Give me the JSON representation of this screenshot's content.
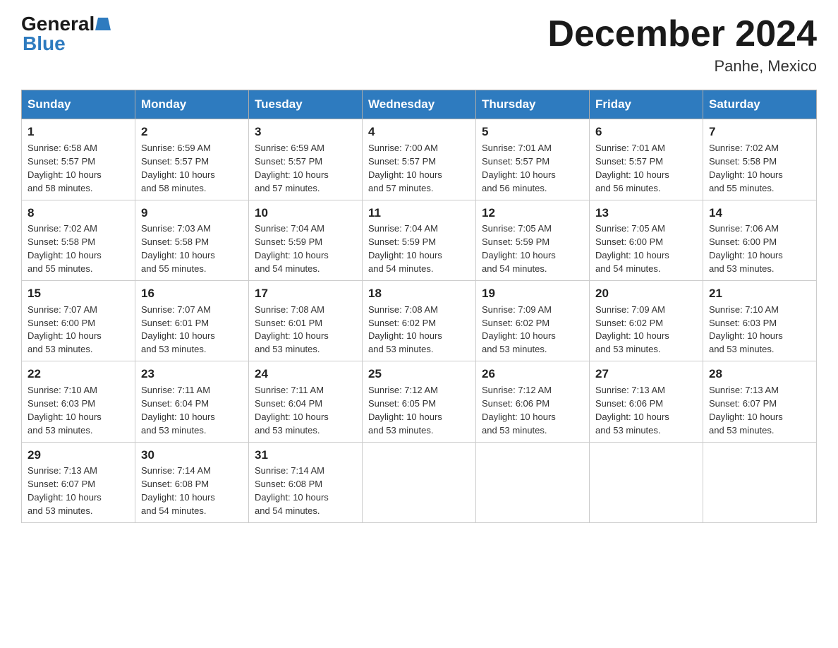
{
  "header": {
    "logo_general": "General",
    "logo_blue": "Blue",
    "month_title": "December 2024",
    "location": "Panhe, Mexico"
  },
  "weekdays": [
    "Sunday",
    "Monday",
    "Tuesday",
    "Wednesday",
    "Thursday",
    "Friday",
    "Saturday"
  ],
  "weeks": [
    [
      {
        "day": "1",
        "info": "Sunrise: 6:58 AM\nSunset: 5:57 PM\nDaylight: 10 hours\nand 58 minutes."
      },
      {
        "day": "2",
        "info": "Sunrise: 6:59 AM\nSunset: 5:57 PM\nDaylight: 10 hours\nand 58 minutes."
      },
      {
        "day": "3",
        "info": "Sunrise: 6:59 AM\nSunset: 5:57 PM\nDaylight: 10 hours\nand 57 minutes."
      },
      {
        "day": "4",
        "info": "Sunrise: 7:00 AM\nSunset: 5:57 PM\nDaylight: 10 hours\nand 57 minutes."
      },
      {
        "day": "5",
        "info": "Sunrise: 7:01 AM\nSunset: 5:57 PM\nDaylight: 10 hours\nand 56 minutes."
      },
      {
        "day": "6",
        "info": "Sunrise: 7:01 AM\nSunset: 5:57 PM\nDaylight: 10 hours\nand 56 minutes."
      },
      {
        "day": "7",
        "info": "Sunrise: 7:02 AM\nSunset: 5:58 PM\nDaylight: 10 hours\nand 55 minutes."
      }
    ],
    [
      {
        "day": "8",
        "info": "Sunrise: 7:02 AM\nSunset: 5:58 PM\nDaylight: 10 hours\nand 55 minutes."
      },
      {
        "day": "9",
        "info": "Sunrise: 7:03 AM\nSunset: 5:58 PM\nDaylight: 10 hours\nand 55 minutes."
      },
      {
        "day": "10",
        "info": "Sunrise: 7:04 AM\nSunset: 5:59 PM\nDaylight: 10 hours\nand 54 minutes."
      },
      {
        "day": "11",
        "info": "Sunrise: 7:04 AM\nSunset: 5:59 PM\nDaylight: 10 hours\nand 54 minutes."
      },
      {
        "day": "12",
        "info": "Sunrise: 7:05 AM\nSunset: 5:59 PM\nDaylight: 10 hours\nand 54 minutes."
      },
      {
        "day": "13",
        "info": "Sunrise: 7:05 AM\nSunset: 6:00 PM\nDaylight: 10 hours\nand 54 minutes."
      },
      {
        "day": "14",
        "info": "Sunrise: 7:06 AM\nSunset: 6:00 PM\nDaylight: 10 hours\nand 53 minutes."
      }
    ],
    [
      {
        "day": "15",
        "info": "Sunrise: 7:07 AM\nSunset: 6:00 PM\nDaylight: 10 hours\nand 53 minutes."
      },
      {
        "day": "16",
        "info": "Sunrise: 7:07 AM\nSunset: 6:01 PM\nDaylight: 10 hours\nand 53 minutes."
      },
      {
        "day": "17",
        "info": "Sunrise: 7:08 AM\nSunset: 6:01 PM\nDaylight: 10 hours\nand 53 minutes."
      },
      {
        "day": "18",
        "info": "Sunrise: 7:08 AM\nSunset: 6:02 PM\nDaylight: 10 hours\nand 53 minutes."
      },
      {
        "day": "19",
        "info": "Sunrise: 7:09 AM\nSunset: 6:02 PM\nDaylight: 10 hours\nand 53 minutes."
      },
      {
        "day": "20",
        "info": "Sunrise: 7:09 AM\nSunset: 6:02 PM\nDaylight: 10 hours\nand 53 minutes."
      },
      {
        "day": "21",
        "info": "Sunrise: 7:10 AM\nSunset: 6:03 PM\nDaylight: 10 hours\nand 53 minutes."
      }
    ],
    [
      {
        "day": "22",
        "info": "Sunrise: 7:10 AM\nSunset: 6:03 PM\nDaylight: 10 hours\nand 53 minutes."
      },
      {
        "day": "23",
        "info": "Sunrise: 7:11 AM\nSunset: 6:04 PM\nDaylight: 10 hours\nand 53 minutes."
      },
      {
        "day": "24",
        "info": "Sunrise: 7:11 AM\nSunset: 6:04 PM\nDaylight: 10 hours\nand 53 minutes."
      },
      {
        "day": "25",
        "info": "Sunrise: 7:12 AM\nSunset: 6:05 PM\nDaylight: 10 hours\nand 53 minutes."
      },
      {
        "day": "26",
        "info": "Sunrise: 7:12 AM\nSunset: 6:06 PM\nDaylight: 10 hours\nand 53 minutes."
      },
      {
        "day": "27",
        "info": "Sunrise: 7:13 AM\nSunset: 6:06 PM\nDaylight: 10 hours\nand 53 minutes."
      },
      {
        "day": "28",
        "info": "Sunrise: 7:13 AM\nSunset: 6:07 PM\nDaylight: 10 hours\nand 53 minutes."
      }
    ],
    [
      {
        "day": "29",
        "info": "Sunrise: 7:13 AM\nSunset: 6:07 PM\nDaylight: 10 hours\nand 53 minutes."
      },
      {
        "day": "30",
        "info": "Sunrise: 7:14 AM\nSunset: 6:08 PM\nDaylight: 10 hours\nand 54 minutes."
      },
      {
        "day": "31",
        "info": "Sunrise: 7:14 AM\nSunset: 6:08 PM\nDaylight: 10 hours\nand 54 minutes."
      },
      null,
      null,
      null,
      null
    ]
  ]
}
